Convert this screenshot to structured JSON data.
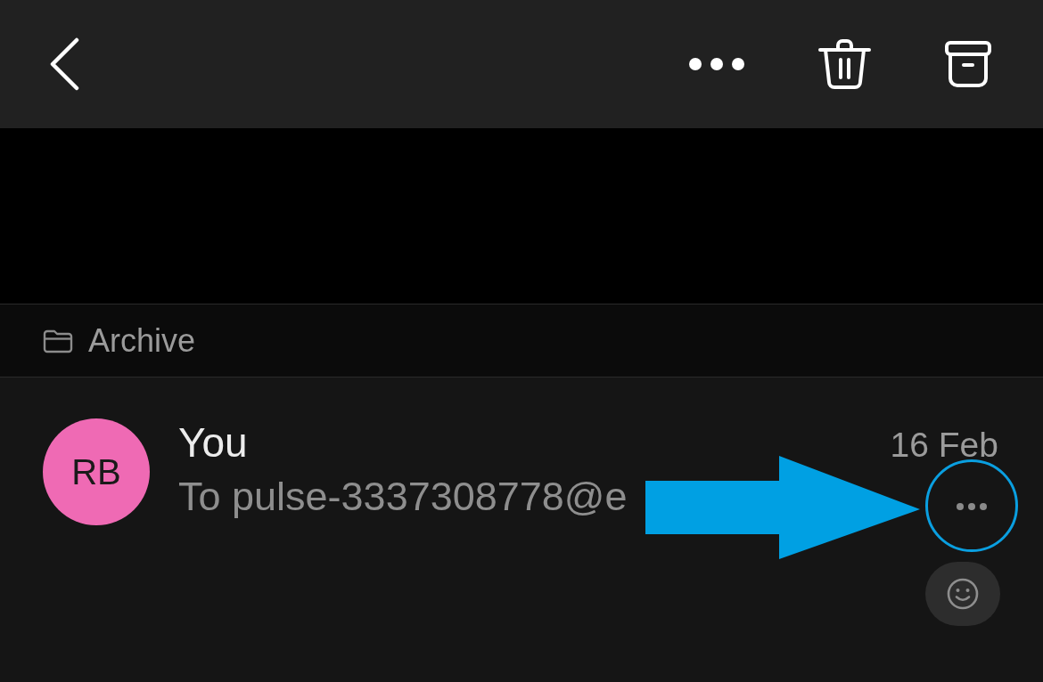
{
  "toolbar": {
    "buttons": [
      {
        "kind": "back"
      },
      {
        "kind": "more"
      },
      {
        "kind": "delete"
      },
      {
        "kind": "archive"
      }
    ]
  },
  "folder": {
    "label": "Archive"
  },
  "message": {
    "avatar": {
      "initials": "RB",
      "color": "#ef6ab4"
    },
    "sender": "You",
    "date": "16 Feb",
    "preview": "To pulse-3337308778@e",
    "actions": [
      {
        "kind": "more"
      },
      {
        "kind": "react"
      }
    ]
  },
  "annotations": [
    {
      "kind": "arrow"
    },
    {
      "kind": "ring"
    }
  ]
}
